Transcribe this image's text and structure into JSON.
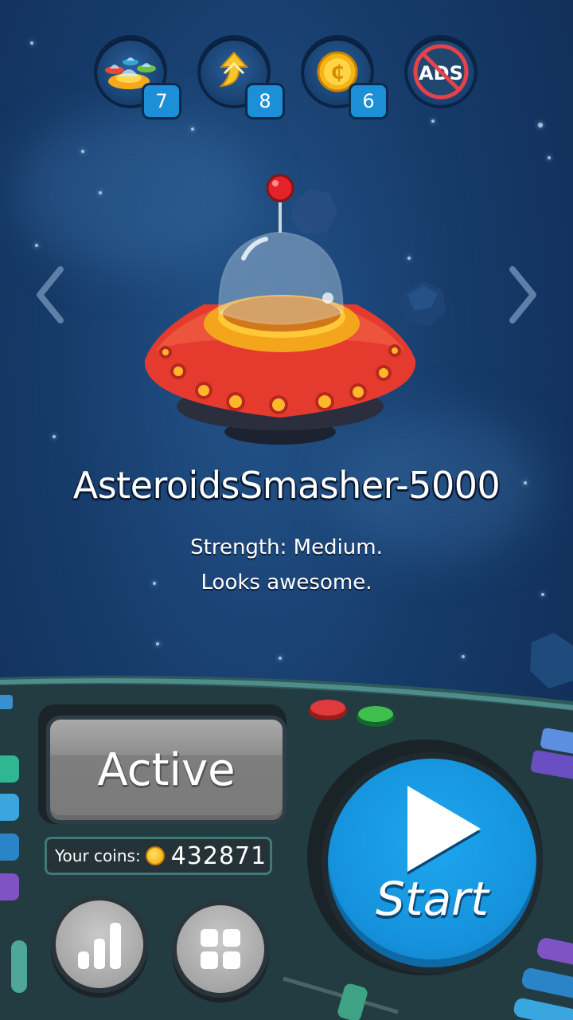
{
  "boosters": [
    {
      "name": "ufo-fleet",
      "count": "7"
    },
    {
      "name": "boost-arrow",
      "count": "8"
    },
    {
      "name": "coin",
      "count": "6"
    },
    {
      "name": "no-ads",
      "label": "ADS"
    }
  ],
  "ship": {
    "name": "AsteroidsSmasher-5000",
    "strength": "Strength: Medium.",
    "looks": "Looks awesome."
  },
  "dashboard": {
    "status_label": "Active",
    "coins_label": "Your coins:",
    "coins_value": "432871",
    "start_label": "Start"
  },
  "colors": {
    "space_bg": "#163b6a",
    "start_blue": "#1693dd",
    "ufo_red": "#e53b2f",
    "dash_teal": "#2f5a5c"
  }
}
